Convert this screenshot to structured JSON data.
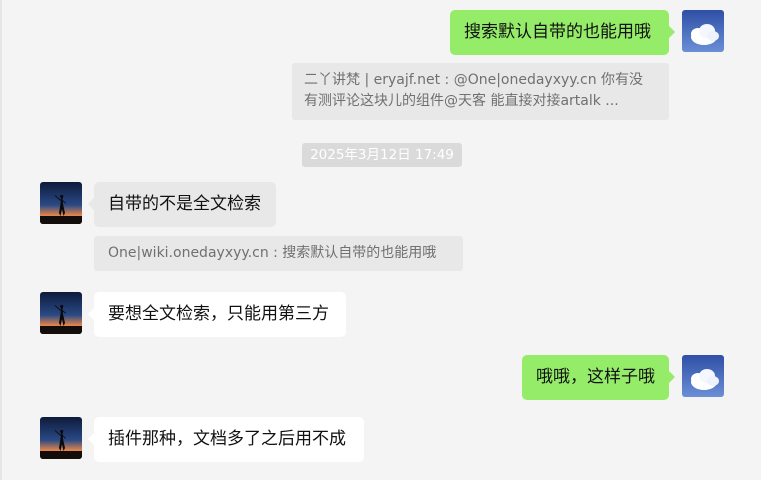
{
  "messages": {
    "m1": {
      "text": "搜索默认自带的也能用哦"
    },
    "q1": {
      "line1": "二丫讲梵 | eryajf.net : @One|onedayxyy.cn 你有没",
      "line2": "有测评论这块儿的组件@天客  能直接对接artalk ..."
    },
    "timestamp": "2025年3月12日 17:49",
    "m2": {
      "text": "自带的不是全文检索"
    },
    "q2": {
      "text": "One|wiki.onedayxyy.cn : 搜索默认自带的也能用哦"
    },
    "m3": {
      "text": "要想全文检索，只能用第三方"
    },
    "m4": {
      "text": "哦哦，这样子哦"
    },
    "m5": {
      "text": "插件那种，文档多了之后用不成"
    }
  },
  "colors": {
    "background": "#f4f4f4",
    "sent_bubble": "#95ec69",
    "received_bubble": "#ffffff",
    "quote_bg": "#e8e8e8",
    "timestamp_bg": "#dadada"
  },
  "icons": {
    "self_avatar": "sky-cloud-avatar",
    "other_avatar": "sunset-silhouette-avatar"
  }
}
